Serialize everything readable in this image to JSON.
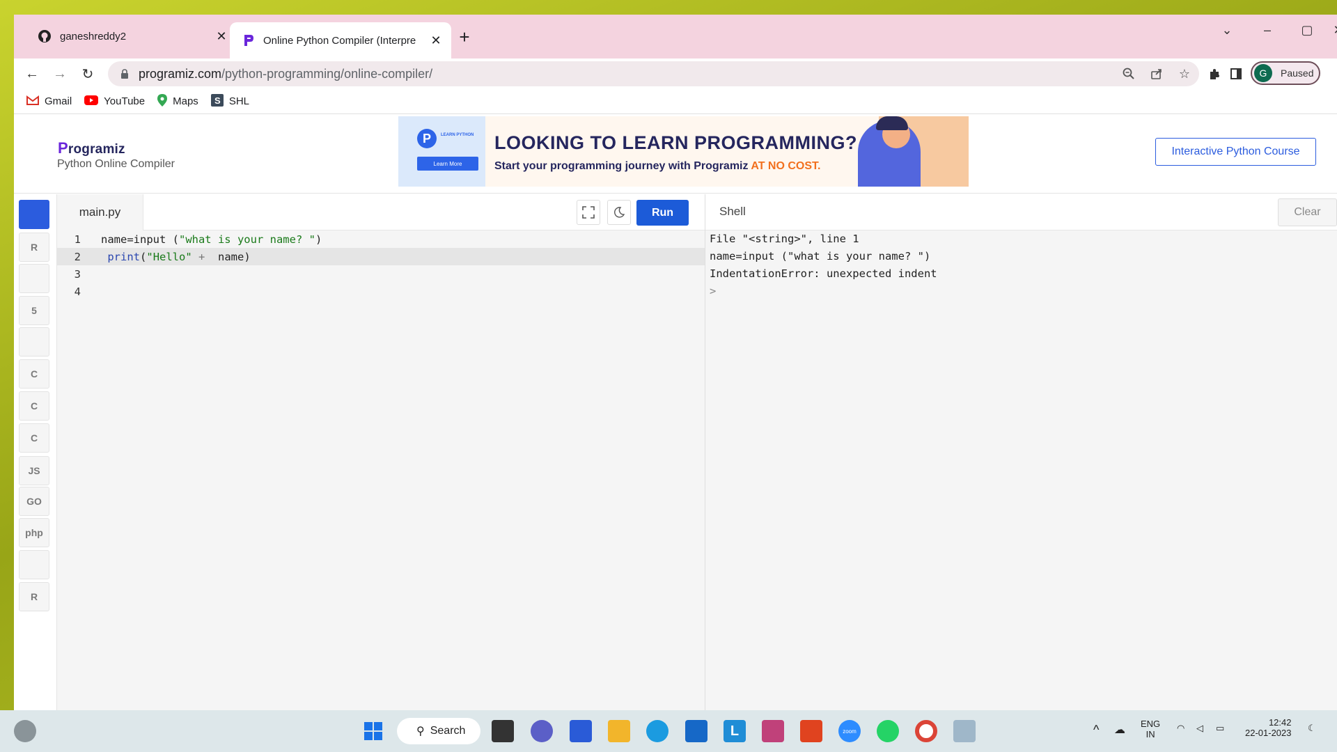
{
  "browser": {
    "tabs": [
      {
        "title": "ganeshreddy2",
        "active": false
      },
      {
        "title": "Online Python Compiler (Interpre",
        "active": true
      }
    ],
    "url_host": "programiz.com",
    "url_path": "/python-programming/online-compiler/",
    "profile_initial": "G",
    "profile_label": "Paused",
    "bookmarks": [
      {
        "label": "Gmail",
        "icon": "gmail-icon"
      },
      {
        "label": "YouTube",
        "icon": "youtube-icon"
      },
      {
        "label": "Maps",
        "icon": "maps-icon"
      },
      {
        "label": "SHL",
        "icon": "shl-icon"
      }
    ]
  },
  "site": {
    "logo": "rogramiz",
    "logo_p": "P",
    "subtitle": "Python Online Compiler",
    "banner_badge": "P",
    "banner_learn": "LEARN PYTHON",
    "banner_button": "Learn More",
    "banner_headline": "LOOKING TO LEARN PROGRAMMING?",
    "banner_sub_a": "Start your programming journey with Programiz ",
    "banner_sub_b": "AT NO COST.",
    "course_button": "Interactive Python Course"
  },
  "sidebar": {
    "langs": [
      {
        "icon": "python-icon",
        "label": "",
        "active": true
      },
      {
        "icon": "r-icon",
        "label": "R",
        "active": false
      },
      {
        "icon": "sql-database-icon",
        "label": "",
        "active": false
      },
      {
        "icon": "html5-icon",
        "label": "5",
        "active": false
      },
      {
        "icon": "java-icon",
        "label": "",
        "active": false
      },
      {
        "icon": "c-icon",
        "label": "C",
        "active": false
      },
      {
        "icon": "cpp-icon",
        "label": "C",
        "active": false
      },
      {
        "icon": "csharp-icon",
        "label": "C",
        "active": false
      },
      {
        "icon": "javascript-icon",
        "label": "JS",
        "active": false
      },
      {
        "icon": "go-icon",
        "label": "GO",
        "active": false
      },
      {
        "icon": "php-icon",
        "label": "php",
        "active": false
      },
      {
        "icon": "swift-icon",
        "label": "",
        "active": false
      },
      {
        "icon": "rust-icon",
        "label": "R",
        "active": false
      }
    ]
  },
  "editor": {
    "file_tab": "main.py",
    "run_label": "Run",
    "lines": [
      {
        "num": "1"
      },
      {
        "num": "2"
      },
      {
        "num": "3"
      },
      {
        "num": "4"
      }
    ],
    "line1_a": "name=input (",
    "line1_str": "\"what is your name? \"",
    "line1_b": ")",
    "line2_indent": " ",
    "line2_kw": "print",
    "line2_open": "(",
    "line2_str": "\"Hello\"",
    "line2_op": " +  ",
    "line2_b": "name)"
  },
  "shell": {
    "title": "Shell",
    "clear_label": "Clear",
    "output": [
      "File \"<string>\", line 1",
      "name=input (\"what is your name? \")",
      "IndentationError: unexpected indent"
    ],
    "prompt": ">"
  },
  "taskbar": {
    "search_label": "Search",
    "lang_top": "ENG",
    "lang_bottom": "IN",
    "time": "12:42",
    "date": "22-01-2023"
  }
}
